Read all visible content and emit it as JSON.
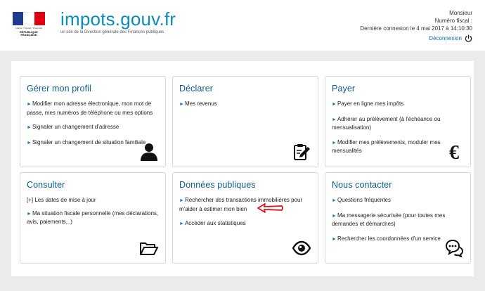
{
  "header": {
    "republic_motto": "Liberté • Égalité • Fraternité",
    "republic_name": "RÉPUBLIQUE FRANÇAISE",
    "brand_title": "impots.gouv.fr",
    "brand_subtitle": "un site de la Direction générale des Finances publiques",
    "user_title": "Monsieur",
    "fiscal_number_label": "Numéro fiscal :",
    "last_login": "Dernière connexion le 4 mai 2017 à 14:10:30",
    "logout_label": "Déconnexion"
  },
  "colors": {
    "flag_blue": "#1f3b8f",
    "flag_white": "#ffffff",
    "flag_red": "#e1000f",
    "brand": "#0a8db8",
    "card_title": "#0a5e8d",
    "bullet": "#1879b5",
    "annotation_arrow": "#d9161c"
  },
  "cards": {
    "profil": {
      "title": "Gérer mon profil",
      "links": [
        "Modifier mon adresse électronique, mon mot de passe, mes numéros de téléphone ou mes options",
        "Signaler un changement d'adresse",
        "Signaler un changement de situation familiale"
      ],
      "icon": "user-icon"
    },
    "declarer": {
      "title": "Déclarer",
      "links": [
        "Mes revenus"
      ],
      "icon": "form-edit-icon"
    },
    "payer": {
      "title": "Payer",
      "links": [
        "Payer en ligne mes impôts",
        "Adhérer au prélèvement (à l'échéance ou mensualisation)",
        "Modifier mes prélèvements, moduler mes mensualités"
      ],
      "icon": "euro-icon"
    },
    "consulter": {
      "title": "Consulter",
      "toggle_label": "[+] Les dates de mise à jour",
      "links": [
        "Ma situation fiscale personnelle (mes déclarations, avis, paiements...)"
      ],
      "icon": "folder-open-icon"
    },
    "donnees": {
      "title": "Données publiques",
      "links": [
        "Rechercher des transactions immobilières pour m'aider à estimer mon bien",
        "Accéder aux statistiques"
      ],
      "icon": "eye-icon"
    },
    "contact": {
      "title": "Nous contacter",
      "links": [
        "Questions fréquentes",
        "Ma messagerie sécurisée (pour toutes mes demandes et démarches)",
        "Rechercher les coordonnées d'un service"
      ],
      "icon": "chat-bubbles-icon"
    }
  }
}
